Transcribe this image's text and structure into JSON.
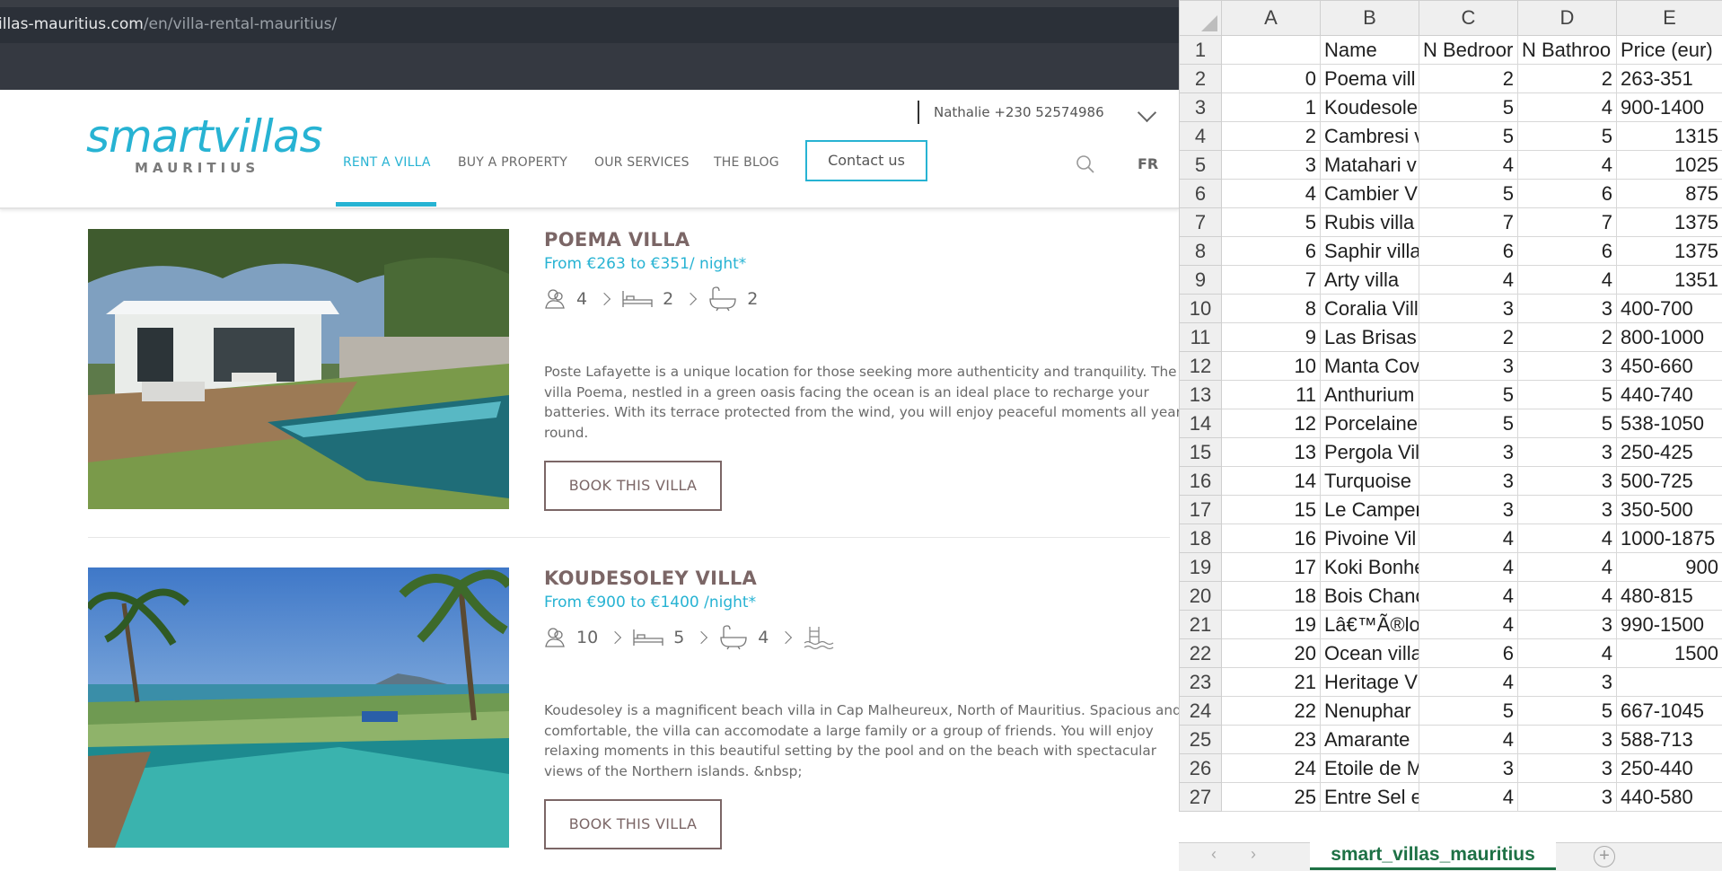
{
  "browser": {
    "url_prefix": "illas-mauritius.com",
    "url_path": "/en/villa-rental-mauritius/"
  },
  "site": {
    "logo_word": "smartvillas",
    "logo_sub": "MAURITIUS",
    "contact_line": "Nathalie +230 52574986",
    "nav": [
      "RENT A VILLA",
      "BUY A PROPERTY",
      "OUR SERVICES",
      "THE BLOG"
    ],
    "contact_button": "Contact us",
    "lang": "FR",
    "accent": "#27b3d3",
    "brown": "#7b6666"
  },
  "villas": [
    {
      "name": "POEMA VILLA",
      "price": "From €263 to €351/ night*",
      "guests": "4",
      "bedrooms": "2",
      "bathrooms": "2",
      "description": "Poste Lafayette is a unique location for those seeking more authenticity and tranquility. The villa Poema, nestled in a  green oasis facing the ocean is an ideal place to recharge your batteries.  With its terrace protected from the wind, you will enjoy peaceful moments all year round.",
      "button": "BOOK THIS VILLA"
    },
    {
      "name": "KOUDESOLEY VILLA",
      "price": "From €900 to €1400 /night*",
      "guests": "10",
      "bedrooms": "5",
      "bathrooms": "4",
      "description": "Koudesoley is a magnificent beach villa in Cap Malheureux, North of Mauritius. Spacious and comfortable, the villa can accomodate a large family or a group of friends.  You will enjoy relaxing moments in this beautiful setting by the pool and on the beach with spectacular views of the Northern islands. &nbsp;",
      "button": "BOOK THIS VILLA"
    }
  ],
  "sheet": {
    "columns": [
      "A",
      "B",
      "C",
      "D",
      "E"
    ],
    "header_row": [
      "",
      "Name",
      "N Bedroor",
      "N Bathroo",
      "Price (eur)"
    ],
    "rows": [
      [
        "0",
        "Poema vill",
        "2",
        "2",
        "263-351"
      ],
      [
        "1",
        "Koudesole",
        "5",
        "4",
        "900-1400"
      ],
      [
        "2",
        "Cambresi v",
        "5",
        "5",
        "1315"
      ],
      [
        "3",
        "Matahari v",
        "4",
        "4",
        "1025"
      ],
      [
        "4",
        "Cambier V",
        "5",
        "6",
        "875"
      ],
      [
        "5",
        "Rubis villa",
        "7",
        "7",
        "1375"
      ],
      [
        "6",
        "Saphir villa",
        "6",
        "6",
        "1375"
      ],
      [
        "7",
        "Arty villa",
        "4",
        "4",
        "1351"
      ],
      [
        "8",
        "Coralia Vill",
        "3",
        "3",
        "400-700"
      ],
      [
        "9",
        "Las Brisas v",
        "2",
        "2",
        "800-1000"
      ],
      [
        "10",
        "Manta Cov",
        "3",
        "3",
        "450-660"
      ],
      [
        "11",
        "Anthurium",
        "5",
        "5",
        "440-740"
      ],
      [
        "12",
        "Porcelaine",
        "5",
        "5",
        "538-1050"
      ],
      [
        "13",
        "Pergola Vil",
        "3",
        "3",
        "250-425"
      ],
      [
        "14",
        "Turquoise",
        "3",
        "3",
        "500-725"
      ],
      [
        "15",
        "Le Camper",
        "3",
        "3",
        "350-500"
      ],
      [
        "16",
        "Pivoine Vil",
        "4",
        "4",
        "1000-1875"
      ],
      [
        "17",
        "Koki Bonhe",
        "4",
        "4",
        "900"
      ],
      [
        "18",
        "Bois Chanc",
        "4",
        "4",
        "480-815"
      ],
      [
        "19",
        "Lâ€™Ã®lot",
        "4",
        "3",
        "990-1500"
      ],
      [
        "20",
        "Ocean villa",
        "6",
        "4",
        "1500"
      ],
      [
        "21",
        "Heritage V",
        "4",
        "3",
        ""
      ],
      [
        "22",
        "Nenuphar",
        "5",
        "5",
        "667-1045"
      ],
      [
        "23",
        "Amarante",
        "4",
        "3",
        "588-713"
      ],
      [
        "24",
        "Etoile de M",
        "3",
        "3",
        "250-440"
      ],
      [
        "25",
        "Entre Sel e",
        "4",
        "3",
        "440-580"
      ]
    ],
    "row_numbers": [
      "1",
      "2",
      "3",
      "4",
      "5",
      "6",
      "7",
      "8",
      "9",
      "10",
      "11",
      "12",
      "13",
      "14",
      "15",
      "16",
      "17",
      "18",
      "19",
      "20",
      "21",
      "22",
      "23",
      "24",
      "25",
      "26",
      "27"
    ],
    "tab_name": "smart_villas_mauritius",
    "tab_prev": "‹",
    "tab_next": "›",
    "add_sheet": "+",
    "tab_color": "#1e7145"
  }
}
